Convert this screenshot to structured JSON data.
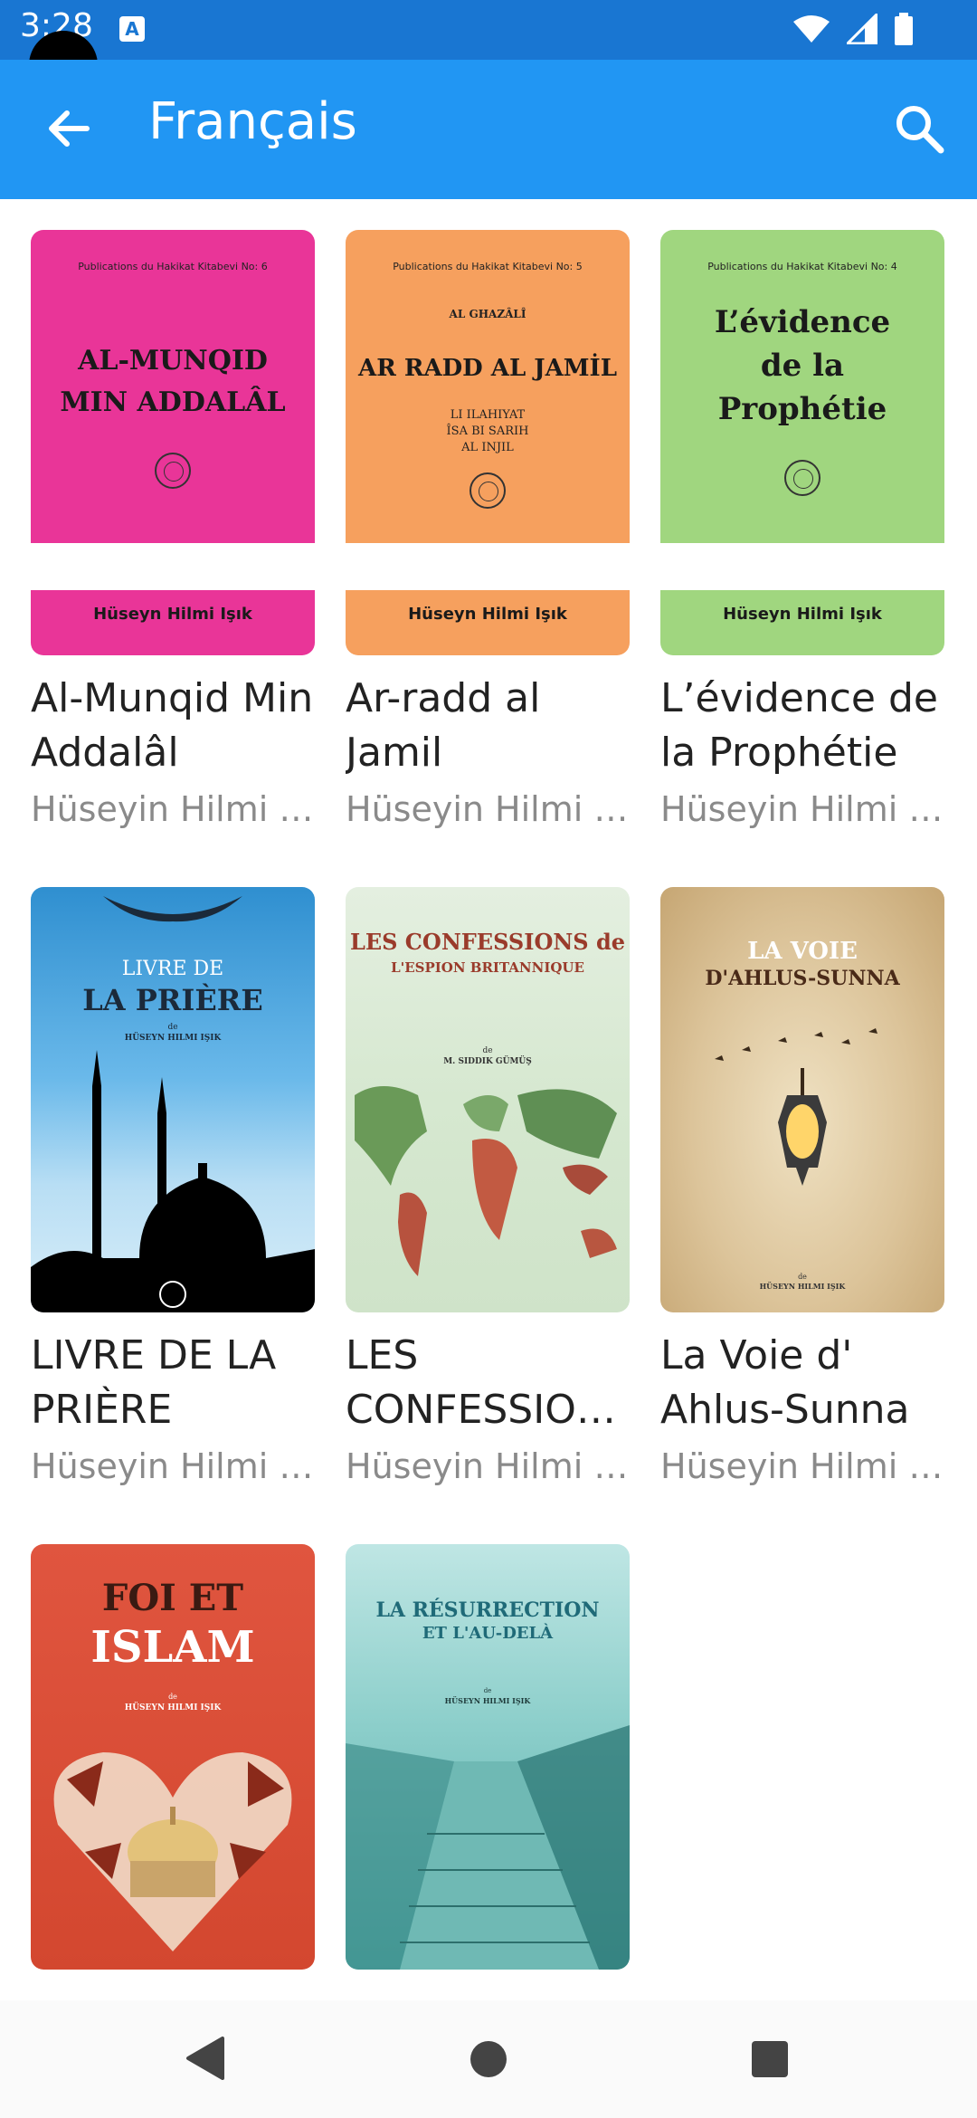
{
  "status": {
    "time": "3:28",
    "a_icon": "A"
  },
  "header": {
    "title": "Français",
    "back_icon": "arrow-left-icon",
    "search_icon": "search-icon"
  },
  "books": [
    {
      "title": "Al-Munqid Min Addalâl",
      "author": "Hüseyin Hilmi Işık",
      "cover": {
        "color": "#e93598",
        "publisher": "Publications du Hakikat Kitabevi No: 6",
        "main": "AL-MUNQID MIN ADDALÂL",
        "author": "Hüseyn Hilmi Işık"
      }
    },
    {
      "title": "Ar-radd al Jamil",
      "author": "Hüseyin Hilmi Işık",
      "cover": {
        "color": "#f6a05e",
        "publisher": "Publications du Hakikat Kitabevi No: 5",
        "pre": "AL GHAZÂLÎ",
        "main": "AR RADD AL JAMİL",
        "sub1": "LI ILAHIYAT",
        "sub2": "ÎSA BI SARIH",
        "sub3": "AL INJIL",
        "author": "Hüseyn Hilmi Işık"
      }
    },
    {
      "title": "L’évidence de la Prophétie",
      "author": "Hüseyin Hilmi Işık",
      "cover": {
        "color": "#a0d67f",
        "publisher": "Publications du Hakikat Kitabevi No: 4",
        "main1": "L’évidence",
        "main2": "de la",
        "main3": "Prophétie",
        "author": "Hüseyn Hilmi Işık"
      }
    },
    {
      "title": "LIVRE DE LA PRIÈRE",
      "author": "Hüseyin Hilmi Işık",
      "cover": {
        "line1": "LIVRE DE",
        "line2": "LA PRIÈRE",
        "by": "de",
        "author": "HÜSEYN HILMI IŞIK"
      }
    },
    {
      "title": "LES CONFESSIONS DE L'ESPION BRITANNIQUE",
      "author": "Hüseyin Hilmi Işık",
      "cover": {
        "line1": "LES CONFESSIONS de",
        "line2": "L'ESPION BRITANNIQUE",
        "by": "de",
        "author": "M. SIDDIK GÜMÜŞ"
      }
    },
    {
      "title": "La Voie d' Ahlus-Sunna",
      "author": "Hüseyin Hilmi Işık",
      "cover": {
        "line1": "LA VOIE",
        "line2": "D'AHLUS-SUNNA",
        "by": "de",
        "author": "HÜSEYN HILMI IŞIK"
      }
    },
    {
      "title": "",
      "author": "",
      "cover": {
        "line1": "FOI ET",
        "line2": "ISLAM",
        "by": "de",
        "author": "HÜSEYN HILMI IŞIK"
      }
    },
    {
      "title": "",
      "author": "",
      "cover": {
        "line1": "LA RÉSURRECTION",
        "line2": "ET L'AU-DELÀ",
        "by": "de",
        "author": "HÜSEYN HILMI IŞIK"
      }
    }
  ],
  "nav": {
    "back_icon": "nav-back-icon",
    "home_icon": "nav-home-icon",
    "recents_icon": "nav-recents-icon"
  }
}
